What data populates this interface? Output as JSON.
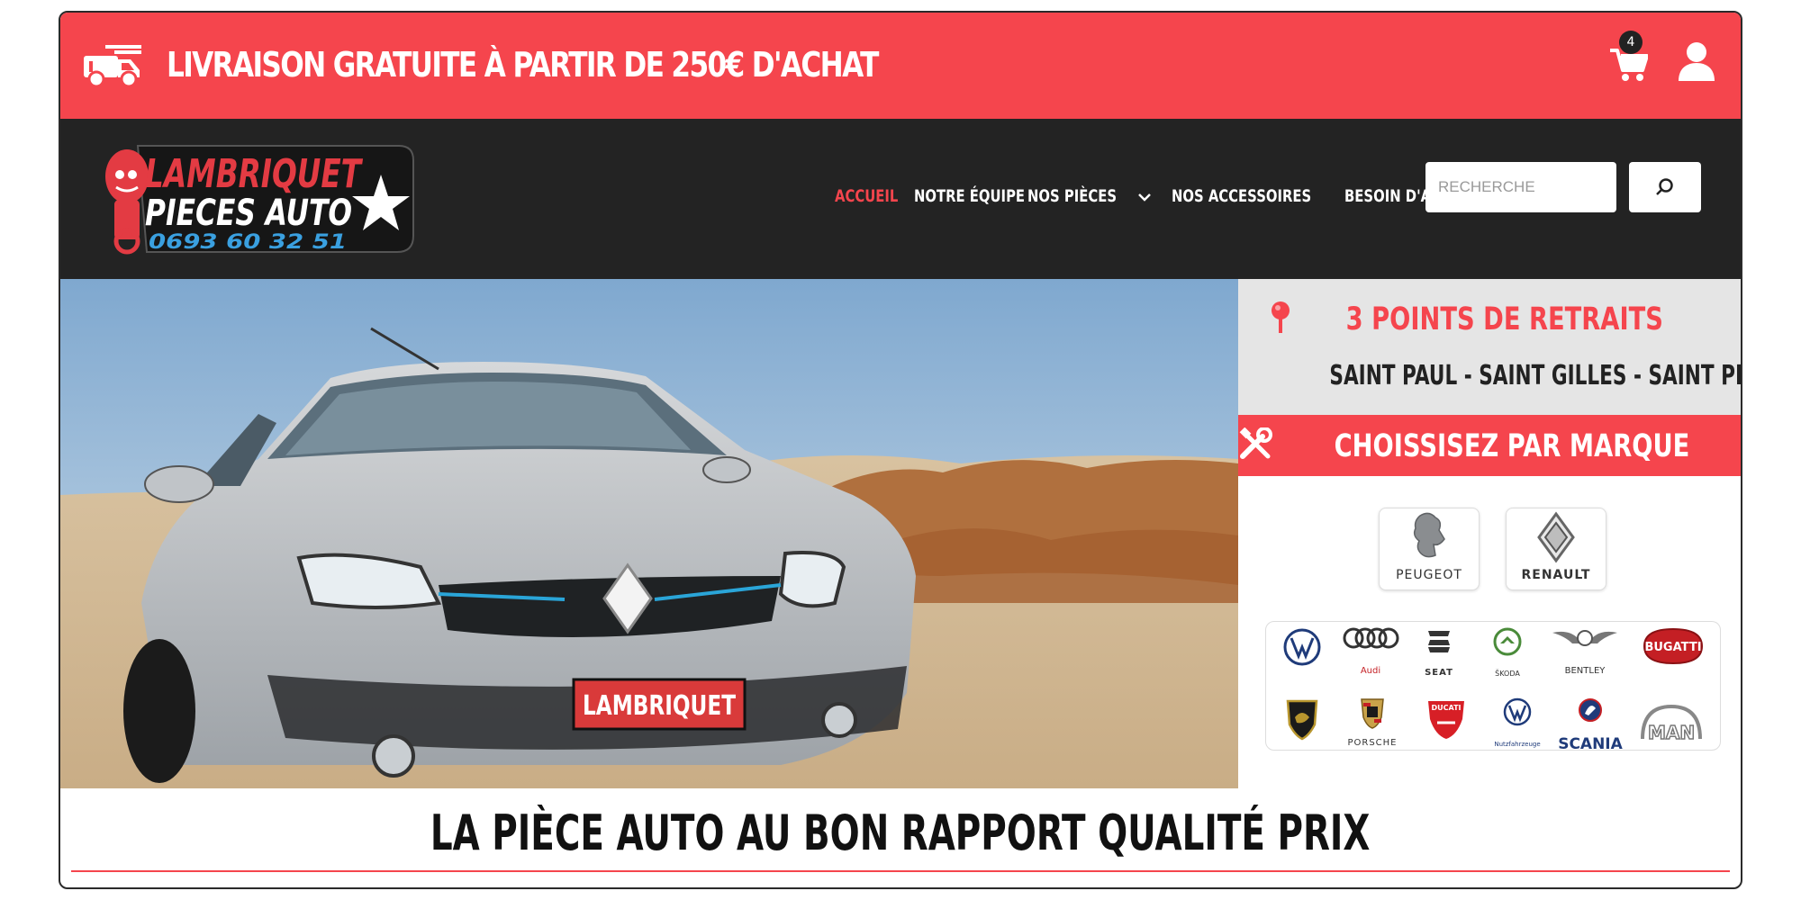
{
  "topbar": {
    "promo": "LIVRAISON GRATUITE À PARTIR DE 250€ D'ACHAT",
    "cart_count": "4",
    "accent": "#f5454d"
  },
  "logo": {
    "line1": "LAMBRIQUET",
    "line2": "PIECES AUTO",
    "phone": "0693 60 32 51"
  },
  "nav": {
    "items": [
      {
        "label": "ACCUEIL",
        "active": true
      },
      {
        "label": "NOTRE ÉQUIPE"
      },
      {
        "label": "NOS PIÈCES"
      },
      {
        "label": "NOS ACCESSOIRES"
      },
      {
        "label": "BESOIN D'AIDE ?"
      }
    ],
    "search_placeholder": "RECHERCHE"
  },
  "hero": {
    "plate": "LAMBRIQUET"
  },
  "side": {
    "points_title": "3 POINTS DE RETRAITS",
    "points_sub": "SAINT PAUL - SAINT GILLES - SAINT PIERRE",
    "brand_title": "CHOISSISEZ PAR MARQUE",
    "featured": [
      "PEUGEOT",
      "RENAULT"
    ],
    "grid": [
      "Audi",
      "SEAT",
      "ŠKODA",
      "BENTLEY",
      "BUGATTI",
      "PORSCHE",
      "DUCATI",
      "Nutzfahrzeuge",
      "SCANIA",
      "MAN"
    ]
  },
  "tagline": "LA PIÈCE AUTO AU BON RAPPORT QUALITÉ PRIX"
}
